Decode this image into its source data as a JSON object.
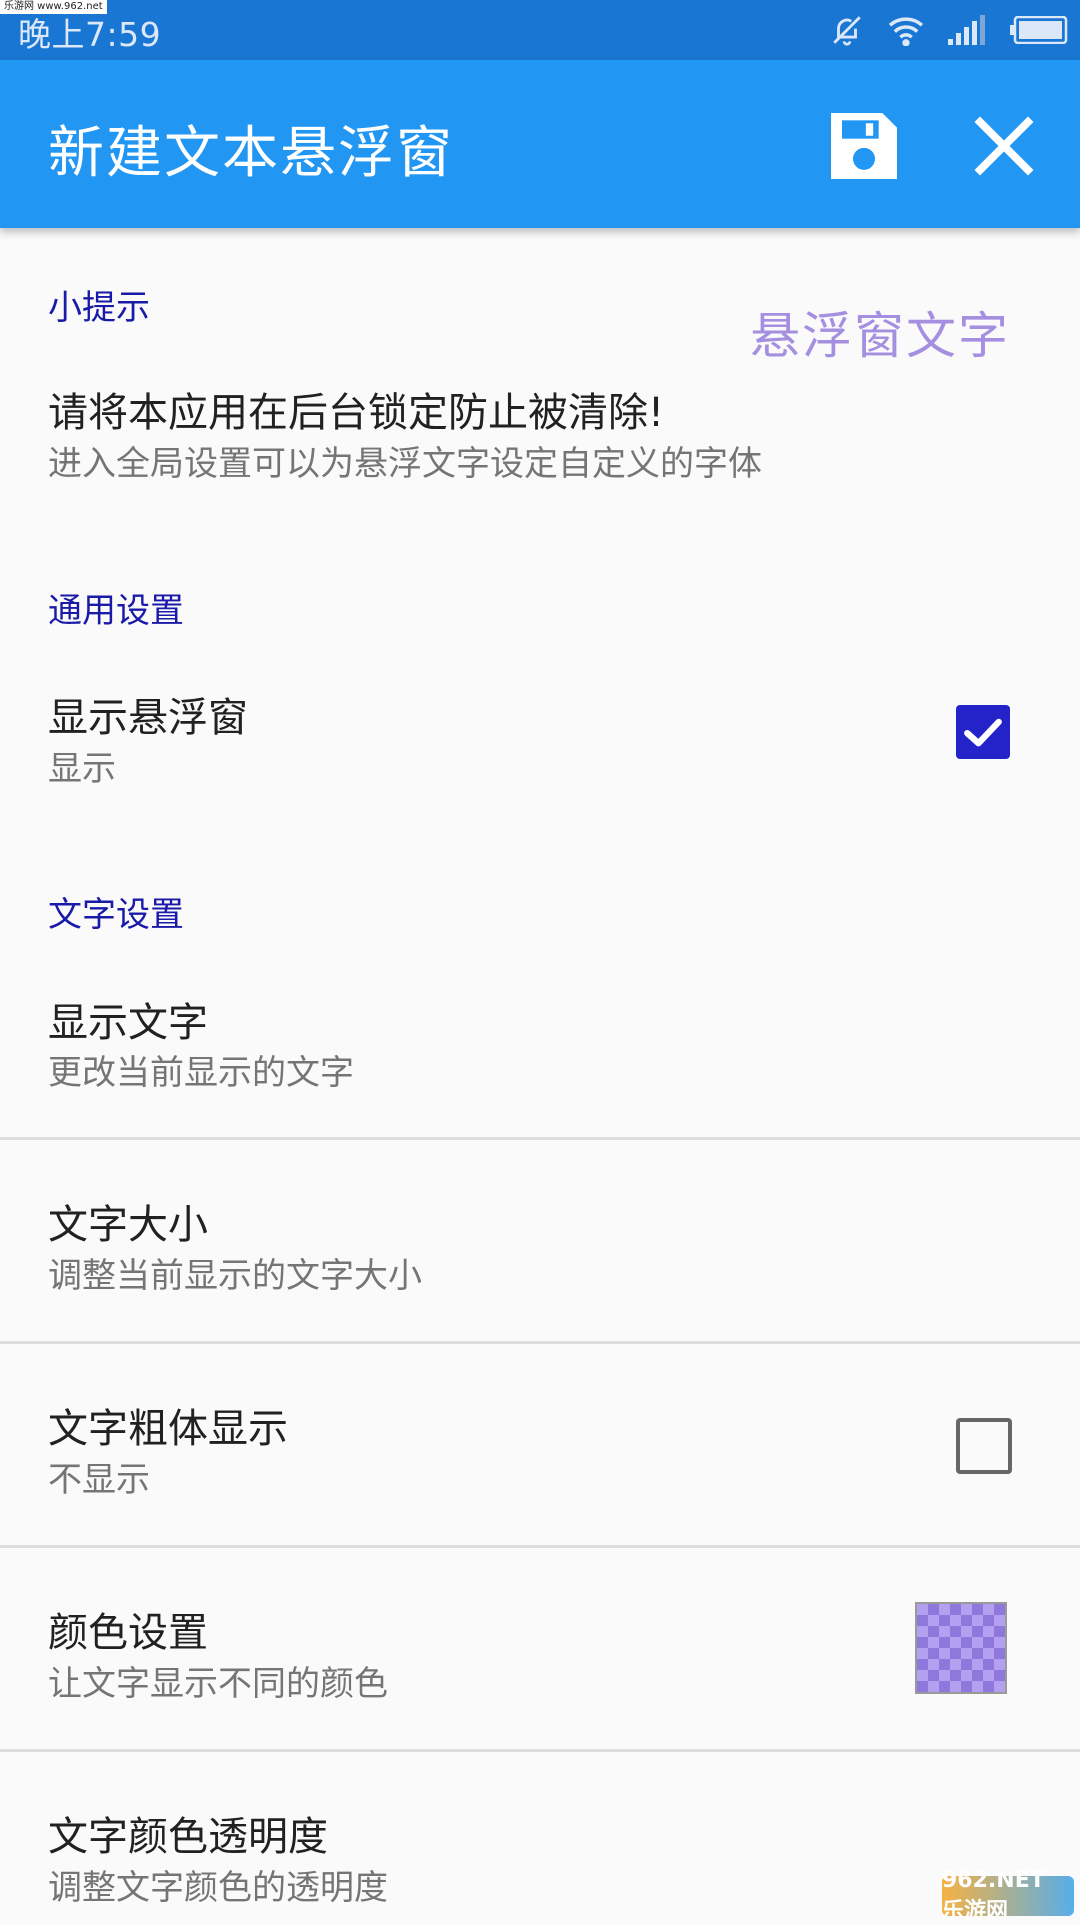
{
  "status_bar": {
    "time": "晚上7:59",
    "watermark": "乐游网 www.962.net",
    "icons": [
      "bell-off-icon",
      "wifi-icon",
      "signal-icon",
      "battery-icon"
    ]
  },
  "app_bar": {
    "title": "新建文本悬浮窗",
    "save_icon": "save-icon",
    "close_icon": "close-icon",
    "color": "#2196f3"
  },
  "tips": {
    "header": "小提示",
    "preview_text": "悬浮窗文字",
    "title": "请将本应用在后台锁定防止被清除!",
    "summary": "进入全局设置可以为悬浮文字设定自定义的字体"
  },
  "general": {
    "header": "通用设置",
    "show_window": {
      "title": "显示悬浮窗",
      "summary": "显示",
      "checked": true
    }
  },
  "text_settings": {
    "header": "文字设置",
    "show_text": {
      "title": "显示文字",
      "summary": "更改当前显示的文字"
    },
    "text_size": {
      "title": "文字大小",
      "summary": "调整当前显示的文字大小"
    },
    "bold": {
      "title": "文字粗体显示",
      "summary": "不显示",
      "checked": false
    },
    "color": {
      "title": "颜色设置",
      "summary": "让文字显示不同的颜色",
      "swatch": "#a58fe0"
    },
    "alpha": {
      "title": "文字颜色透明度",
      "summary": "调整文字颜色的透明度"
    }
  },
  "watermark_bottom": "962.NET 乐游网"
}
